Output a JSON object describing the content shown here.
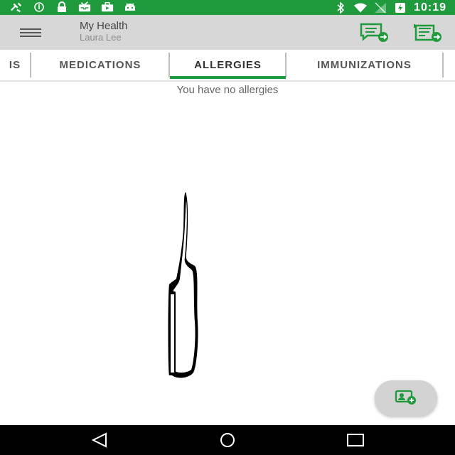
{
  "status_bar": {
    "time": "10:19",
    "left_icons": [
      "satellite-icon",
      "info-circle-icon",
      "lock-icon",
      "inbox-icon",
      "briefcase-icon",
      "android-icon"
    ],
    "right_icons": [
      "bluetooth-icon",
      "wifi-icon",
      "signal-icon",
      "battery-charging-icon"
    ]
  },
  "app_bar": {
    "title": "My Health",
    "subtitle": "Laura Lee"
  },
  "tabs": [
    {
      "label": "IS"
    },
    {
      "label": "MEDICATIONS"
    },
    {
      "label": "ALLERGIES"
    },
    {
      "label": "IMMUNIZATIONS"
    }
  ],
  "active_tab": "ALLERGIES",
  "content": {
    "empty_message": "You have no allergies"
  },
  "colors": {
    "brand": "#1f9a3d",
    "app_bar": "#d7d7d7"
  },
  "nav": [
    "back-icon",
    "home-icon",
    "recents-icon"
  ]
}
